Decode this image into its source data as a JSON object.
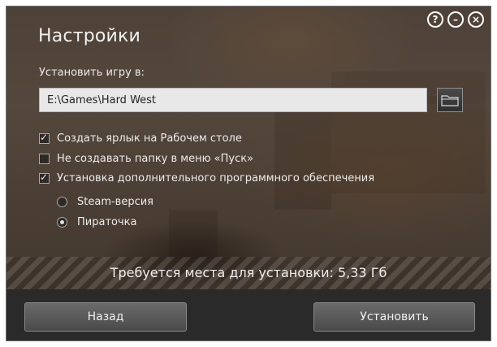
{
  "window": {
    "title": "Настройки",
    "controls": [
      "help-icon",
      "minimize-icon",
      "close-icon"
    ],
    "control_glyphs": {
      "help": "?",
      "minimize": "–",
      "close": "×"
    }
  },
  "install": {
    "label": "Установить игру в:",
    "path": "E:\\Games\\Hard West",
    "browse_icon": "folder-icon"
  },
  "options": [
    {
      "label": "Создать ярлык на Рабочем столе",
      "checked": true
    },
    {
      "label": "Не создавать папку в меню «Пуск»",
      "checked": false
    },
    {
      "label": "Установка дополнительного программного обеспечения",
      "checked": true
    }
  ],
  "version_options": [
    {
      "label": "Steam-версия",
      "selected": false
    },
    {
      "label": "Пираточка",
      "selected": true
    }
  ],
  "space_required": "Требуется места для установки: 5,33 Гб",
  "buttons": {
    "back": "Назад",
    "install": "Установить"
  }
}
